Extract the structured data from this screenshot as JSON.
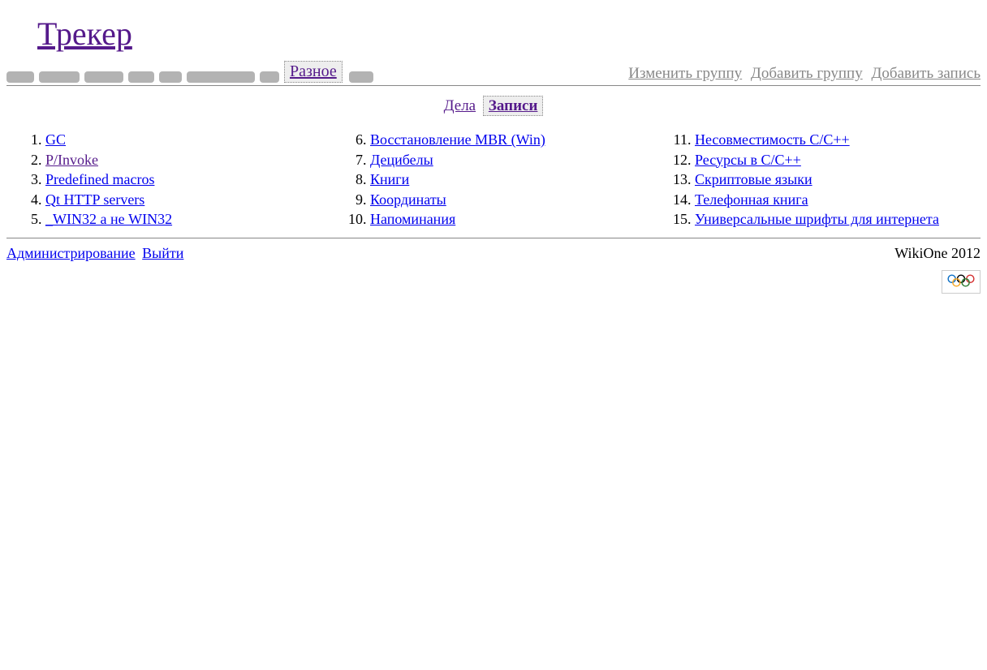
{
  "header": {
    "title": "Трекер"
  },
  "topnav": {
    "active_tab": "Разное"
  },
  "actions": {
    "edit_group": "Изменить группу",
    "add_group": "Добавить группу",
    "add_record": "Добавить запись"
  },
  "subnav": {
    "tasks": "Дела",
    "records": "Записи"
  },
  "items": [
    "GC",
    "P/Invoke",
    "Predefined macros",
    "Qt HTTP servers",
    "_WIN32 а не WIN32",
    "Восстановление MBR (Win)",
    "Децибелы",
    "Книги",
    "Координаты",
    "Напоминания",
    "Несовместимость C/C++",
    "Ресурсы в C/C++",
    "Скриптовые языки",
    "Телефонная книга",
    "Универсальные шрифты для интернета"
  ],
  "footer": {
    "admin": "Администрирование",
    "logout": "Выйти",
    "brand": "WikiOne 2012"
  }
}
